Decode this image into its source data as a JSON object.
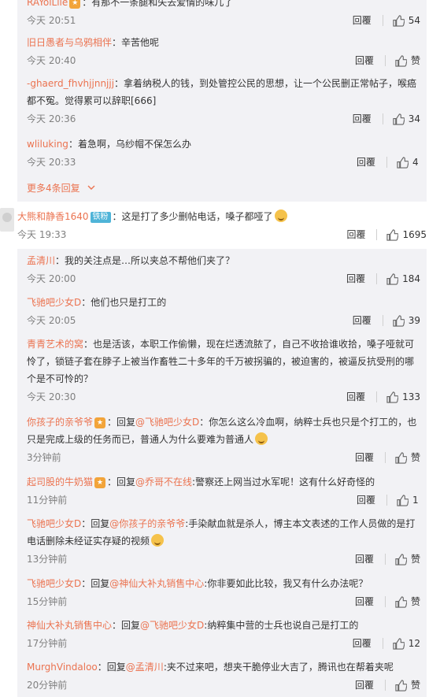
{
  "thread1": {
    "replies": [
      {
        "user": "RAYolLile",
        "text": "：有那不一条腿和失去爱情的味儿了",
        "time": "今天 20:51",
        "likes": "54",
        "has_fan": true
      },
      {
        "user": "旧日愚者与乌鸦相伴",
        "text": "：辛苦他呢",
        "time": "今天 20:40",
        "likes": "赞",
        "has_fan": false
      },
      {
        "user": "-ghaerd_fhvhjjnnjjj",
        "text": "：拿着纳税人的钱，到处管控公民的思想，让一个公民删正常帖子，喉癌都不冤。觉得累可以辞职[666]",
        "time": "今天 20:36",
        "likes": "34",
        "has_fan": false
      },
      {
        "user": "wliluking",
        "text": "：着急啊，乌纱帽不保怎么办",
        "time": "今天 20:33",
        "likes": "4",
        "has_fan": false
      }
    ],
    "more_label": "更多4条回复",
    "more_icon": "chevron-down-icon"
  },
  "main_comment": {
    "user": "大熊和静香1640",
    "badge": "铁粉",
    "text": "：这是打了多少删帖电话，嗓子都哑了",
    "time": "今天 19:33",
    "reply_label": "回覆",
    "likes": "1695"
  },
  "thread2": {
    "replies": [
      {
        "user": "孟清川",
        "text": "：我的关注点是…所以夹总不帮他们夹了？",
        "time": "今天 20:00",
        "likes": "184",
        "has_fan": false,
        "reply_to": ""
      },
      {
        "user": "飞驰吧少女D",
        "text": "：他们也只是打工的",
        "time": "今天 20:05",
        "likes": "39",
        "has_fan": false,
        "reply_to": ""
      },
      {
        "user": "青青艺术的窝",
        "text": "：也是活该，本职工作偷懒，现在烂透流脓了，自己不收拾谁收拾，嗓子哑就可怜了，锁链子套在脖子上被当作畜牲二十多年的千万被拐骗的，被迫害的，被逼反抗受刑的哪个是不可怜的？",
        "time": "今天 20:30",
        "likes": "133",
        "has_fan": false,
        "reply_to": ""
      },
      {
        "user": "你孩子的亲爷爷",
        "text": "：你怎么这么冷血啊，纳粹士兵也只是个打工的，也只是完成上级的任务而已，普通人为什么要难为普通人",
        "time": "3分钟前",
        "likes": "赞",
        "has_fan": true,
        "reply_to": "@飞驰吧少女D",
        "emoji": true
      },
      {
        "user": "起司股的牛奶猫",
        "text": ":警察还上网当过水军呢！这有什么好奇怪的",
        "time": "11分钟前",
        "likes": "1",
        "has_fan": true,
        "reply_to": "@乔哥不在线"
      },
      {
        "user": "飞驰吧少女D",
        "text": ":手染献血就是杀人，博主本文表述的工作人员做的是打电话删除未经证实存疑的视频",
        "time": "13分钟前",
        "likes": "赞",
        "has_fan": false,
        "reply_to": "@你孩子的亲爷爷",
        "emoji": true
      },
      {
        "user": "飞驰吧少女D",
        "text": ":你非要如此比较，我又有什么办法呢？",
        "time": "15分钟前",
        "likes": "赞",
        "has_fan": false,
        "reply_to": "@神仙大补丸销售中心"
      },
      {
        "user": "神仙大补丸销售中心",
        "text": ":纳粹集中营的士兵也说自己是打工的",
        "time": "17分钟前",
        "likes": "12",
        "has_fan": false,
        "reply_to": "@飞驰吧少女D"
      },
      {
        "user": "MurghVindaloo",
        "text": ":夹不过来吧，想夹干脆停业大吉了，腾讯也在帮着夹呢",
        "time": "20分钟前",
        "likes": "赞",
        "has_fan": false,
        "reply_to": "@孟清川"
      }
    ]
  },
  "labels": {
    "reply": "回覆",
    "reply_prefix": "：回复"
  },
  "colors": {
    "username": "#eb7350",
    "panel": "#f2f2f5",
    "meta": "#808080"
  }
}
